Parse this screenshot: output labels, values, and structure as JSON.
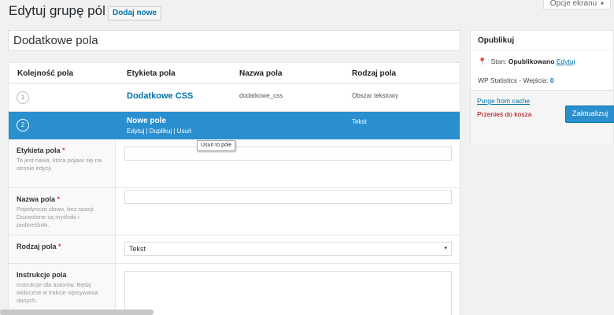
{
  "screen_options": {
    "label": "Opcje ekranu",
    "arrow": "▾"
  },
  "header": {
    "title": "Edytuj grupę pól",
    "add_new": "Dodaj nowe"
  },
  "group_title": {
    "value": "Dodatkowe pola"
  },
  "fields_table": {
    "headers": [
      "Kolejność pola",
      "Etykieta pola",
      "Nazwa pola",
      "Rodzaj pola"
    ],
    "rows": [
      {
        "order": "1",
        "label": "Dodatkowe CSS",
        "name": "dodatkowe_css",
        "type": "Obszar tekstowy"
      },
      {
        "order": "2",
        "label": "Nowe pole",
        "type": "Tekst",
        "actions": {
          "edit": "Edytuj",
          "sep": "|",
          "duplicate": "Duplikuj",
          "delete": "Usuń"
        }
      }
    ]
  },
  "tooltip": "Usuń to pole",
  "field_settings": {
    "label": {
      "title": "Etykieta pola",
      "required": "*",
      "desc": "To jest nawa, która pojawi się na stronie edycji."
    },
    "name": {
      "title": "Nazwa pola",
      "required": "*",
      "desc": "Pojedyncze słowo, bez spacji. Dozwolone są myślniki i podkreślniki."
    },
    "type": {
      "title": "Rodzaj pola",
      "required": "*",
      "selected": "Tekst",
      "caret": "▾"
    },
    "instructions": {
      "title": "Instrukcje pola",
      "desc": "Instrukcje dla autorów. Będą widoczne w trakcie wpisywania danych."
    }
  },
  "publish": {
    "title": "Opublikuj",
    "pin": "📍",
    "status_label": "Stan:",
    "status_value": "Opublikowano",
    "status_edit": "Edytuj",
    "stats_label": "WP Statistics - Wejścia:",
    "stats_value": "0",
    "purge": "Purge from cache",
    "trash": "Przenieś do kosza",
    "update": "Zaktualizuj"
  },
  "colors": {
    "accent": "#2a8fcf",
    "link": "#0073aa",
    "danger": "#a00"
  }
}
